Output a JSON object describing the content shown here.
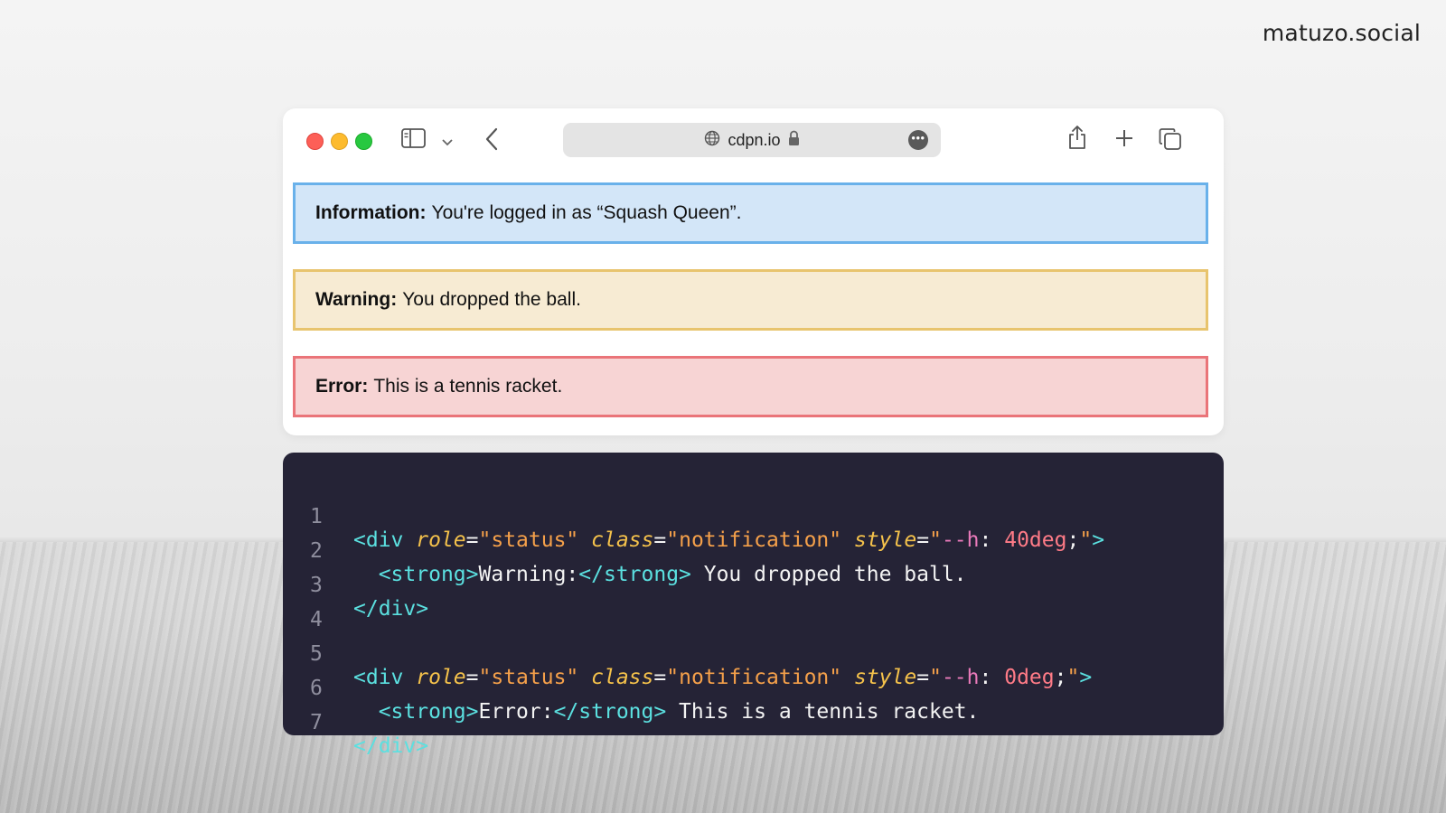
{
  "brand": "matuzo.social",
  "browser": {
    "url": "cdpn.io",
    "icons": [
      "sidebar-icon",
      "chevron-down-icon",
      "back-icon",
      "globe-icon",
      "lock-icon",
      "more-icon",
      "share-icon",
      "plus-icon",
      "tabs-icon"
    ]
  },
  "notifications": [
    {
      "label": "Information:",
      "text": "You're logged in as “Squash Queen”.",
      "color": "#d3e6f8",
      "border": "#69b1ea"
    },
    {
      "label": "Warning:",
      "text": "You dropped the ball.",
      "color": "#f7ebd3",
      "border": "#e8c46e"
    },
    {
      "label": "Error:",
      "text": "This is a tennis racket.",
      "color": "#f7d4d4",
      "border": "#ea7479"
    }
  ],
  "code": {
    "line_numbers": [
      "1",
      "2",
      "3",
      "4",
      "5",
      "6",
      "7"
    ],
    "l1": {
      "open": "<div",
      "a1": "role",
      "eq": "=",
      "v1": "\"status\"",
      "a2": "class",
      "v2": "\"notification\"",
      "a3": "style",
      "q1": "\"",
      "p": "--h",
      "colon": ":",
      "n": "40deg",
      "semi": ";",
      "q2": "\"",
      "close": ">"
    },
    "l2": {
      "open": "<strong>",
      "t": "Warning:",
      "close": "</strong>",
      "rest": " You dropped the ball."
    },
    "l3": {
      "close": "</div>"
    },
    "l5": {
      "open": "<div",
      "a1": "role",
      "eq": "=",
      "v1": "\"status\"",
      "a2": "class",
      "v2": "\"notification\"",
      "a3": "style",
      "q1": "\"",
      "p": "--h",
      "colon": ":",
      "n": "0deg",
      "semi": ";",
      "q2": "\"",
      "close": ">"
    },
    "l6": {
      "open": "<strong>",
      "t": "Error:",
      "close": "</strong>",
      "rest": " This is a tennis racket."
    },
    "l7": {
      "close": "</div>"
    }
  }
}
